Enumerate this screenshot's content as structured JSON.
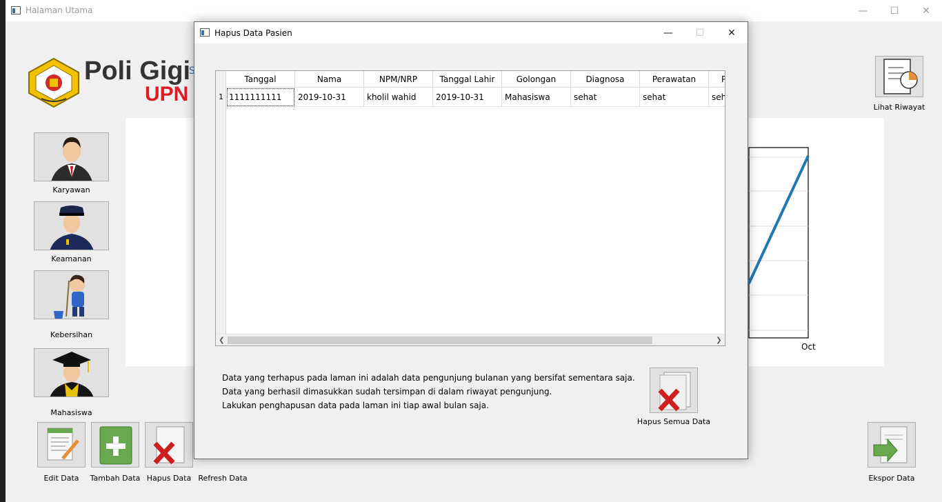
{
  "main": {
    "title": "Halaman Utama",
    "brand_line1": "Poli Gigi",
    "brand_line2": "UPN",
    "brand_s": "S"
  },
  "sidebar": {
    "items": [
      {
        "label": "Karyawan"
      },
      {
        "label": "Keamanan"
      },
      {
        "label": "Kebersihan"
      },
      {
        "label": "Mahasiswa"
      }
    ]
  },
  "toolbar": {
    "edit": "Edit Data",
    "tambah": "Tambah Data",
    "hapus": "Hapus Data",
    "refresh": "Refresh Data",
    "ekspor": "Ekspor Data",
    "riwayat": "Lihat Riwayat"
  },
  "chart": {
    "x_tick": "Oct"
  },
  "dialog": {
    "title": "Hapus Data Pasien",
    "columns": [
      "Tanggal",
      "Nama",
      "NPM/NRP",
      "Tanggal Lahir",
      "Golongan",
      "Diagnosa",
      "Perawatan",
      "P"
    ],
    "rows": [
      {
        "num": "1",
        "cells": [
          "1111111111",
          "2019-10-31",
          "kholil wahid",
          "2019-10-31",
          "Mahasiswa",
          "sehat",
          "sehat",
          "seha"
        ]
      }
    ],
    "info_lines": [
      "Data yang terhapus pada laman ini adalah data pengunjung bulanan yang bersifat sementara saja.",
      "Data yang berhasil dimasukkan sudah tersimpan di dalam riwayat pengunjung.",
      "Lakukan penghapusan data pada laman ini tiap awal bulan saja."
    ],
    "hapus_all": "Hapus Semua Data"
  }
}
